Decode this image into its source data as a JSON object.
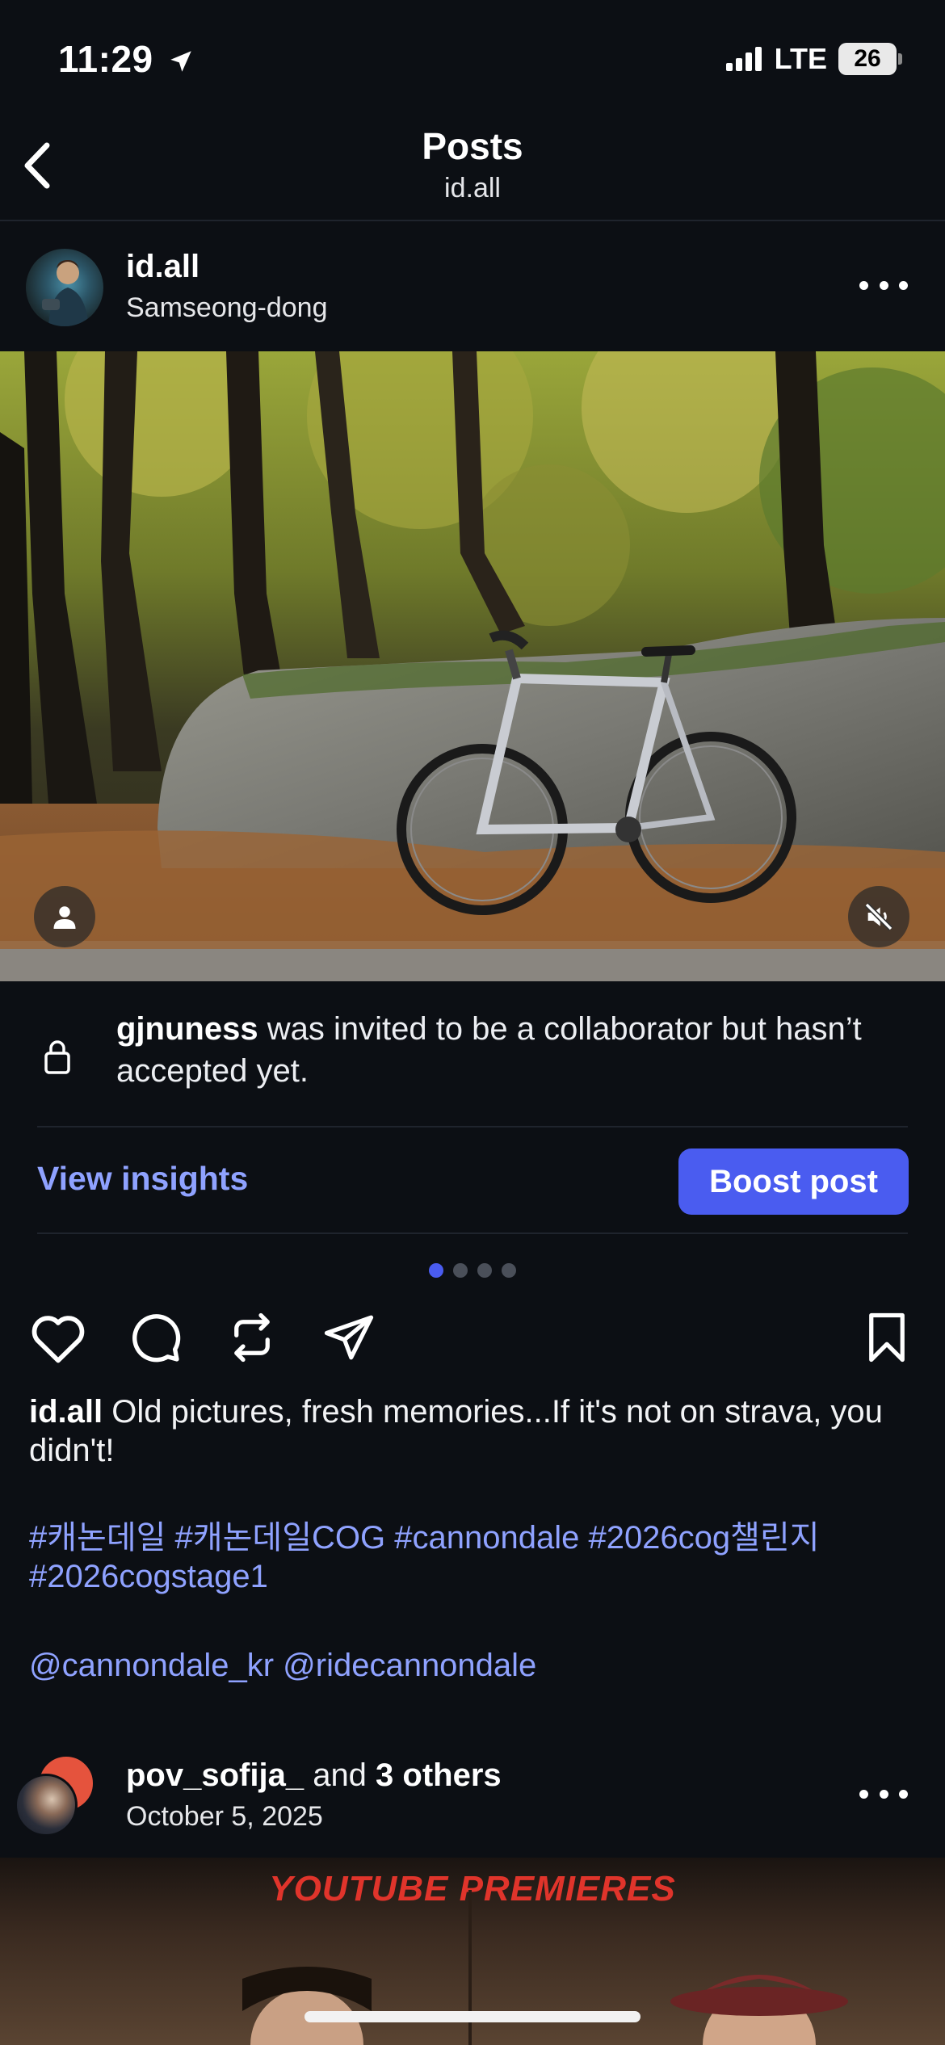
{
  "status_bar": {
    "time": "11:29",
    "network": "LTE",
    "battery": "26"
  },
  "header": {
    "title": "Posts",
    "subtitle": "id.all",
    "back_icon": "chevron-left-icon"
  },
  "post": {
    "username": "id.all",
    "location": "Samseong-dong",
    "collab_user": "gjnuness",
    "collab_text": " was invited to be a collaborator but hasn’t accepted yet.",
    "insights_label": "View insights",
    "boost_label": "Boost post",
    "carousel": {
      "count": 4,
      "active_index": 0
    },
    "caption_user": "id.all",
    "caption_text": " Old pictures, fresh memories...If it's not on strava, you didn't!",
    "hashtags": "#캐논데일 #캐논데일COG #cannondale #2026cog챌린지 #2026cogstage1",
    "mentions": "@cannondale_kr @ridecannondale"
  },
  "next_post": {
    "username": "pov_sofija_",
    "and_text": " and ",
    "others": "3 others",
    "date": "October 5, 2025",
    "thumbnail_text": "YOUTUBE PREMIERES"
  },
  "colors": {
    "background": "#0c0f14",
    "accent": "#4a5cf0",
    "link": "#8fa2ff"
  }
}
